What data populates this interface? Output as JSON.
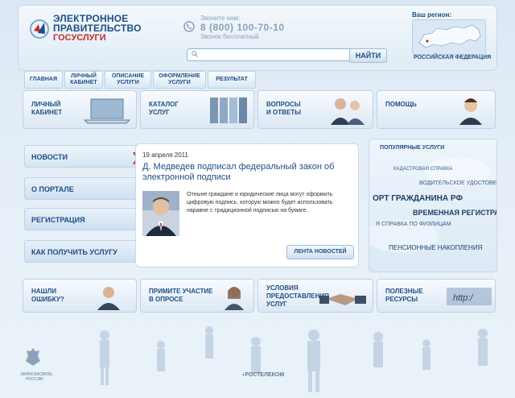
{
  "header": {
    "title_line1": "ЭЛЕКТРОННОЕ",
    "title_line2": "ПРАВИТЕЛЬСТВО",
    "subtitle": "ГОСУСЛУГИ",
    "phone_caption": "Звоните нам:",
    "phone_number": "8 (800) 100-70-10",
    "phone_note": "Звонок бесплатный",
    "search_value": "",
    "search_button": "НАЙТИ",
    "region_caption": "Ваш регион:",
    "region_name": "РОССИЙСКАЯ ФЕДЕРАЦИЯ"
  },
  "breadcrumbs": [
    {
      "label": "ГЛАВНАЯ"
    },
    {
      "label": "ЛИЧНЫЙ КАБИНЕТ"
    },
    {
      "label": "ОПИСАНИЕ УСЛУГИ"
    },
    {
      "label": "ОФОРМЛЕНИЕ УСЛУГИ"
    },
    {
      "label": "РЕЗУЛЬТАТ"
    }
  ],
  "nav_tiles": [
    {
      "line1": "ЛИЧНЫЙ",
      "line2": "КАБИНЕТ"
    },
    {
      "line1": "КАТАЛОГ",
      "line2": "УСЛУГ"
    },
    {
      "line1": "ВОПРОСЫ",
      "line2": "И ОТВЕТЫ"
    },
    {
      "line1": "ПОМОЩЬ",
      "line2": ""
    }
  ],
  "sidebar": {
    "items": [
      {
        "label": "НОВОСТИ"
      },
      {
        "label": "О ПОРТАЛЕ"
      },
      {
        "label": "РЕГИСТРАЦИЯ"
      },
      {
        "label": "КАК ПОЛУЧИТЬ УСЛУГУ"
      }
    ]
  },
  "news": {
    "date": "19 апреля 2011",
    "title": "Д. Медведев подписал федеральный закон об электронной подписи",
    "text": "Отныне граждане и юридические лица могут оформить цифровую подпись, которую можно будет использовать наравне с традиционной подписью на бумаге.",
    "feed_button": "ЛЕНТА НОВОСТЕЙ"
  },
  "popular": {
    "title": "ПОПУЛЯРНЫЕ УСЛУГИ",
    "tags": [
      "КАДАСТРОВАЯ СПРАВКА",
      "ВОДИТЕЛЬСКОЕ УДОСТОВЕ",
      "ОРТ ГРАЖДАНИНА РФ",
      "ВРЕМЕННАЯ РЕГИСТРАЦ",
      "Я СПРАВКА ПО ФИЗЛИЦАМ",
      "ПЕНСИОННЫЕ НАКОПЛЕНИЯ"
    ]
  },
  "bottom_tiles": [
    {
      "line1": "НАШЛИ",
      "line2": "ОШИБКУ?"
    },
    {
      "line1": "ПРИМИТЕ УЧАСТИЕ",
      "line2": "В ОПРОСЕ"
    },
    {
      "line1": "УСЛОВИЯ",
      "line2": "ПРЕДОСТАВЛЕНИЯ",
      "line3": "УСЛУГ"
    },
    {
      "line1": "ПОЛЕЗНЫЕ",
      "line2": "РЕСУРСЫ"
    }
  ],
  "footer": {
    "ministry_line1": "МИНКОМСВЯЗЬ",
    "ministry_line2": "РОССИИ",
    "provider": "РОСТЕЛЕКОМ"
  },
  "colors": {
    "accent": "#1d4f86",
    "alert": "#c62b2b",
    "background": "#e3edf7"
  }
}
